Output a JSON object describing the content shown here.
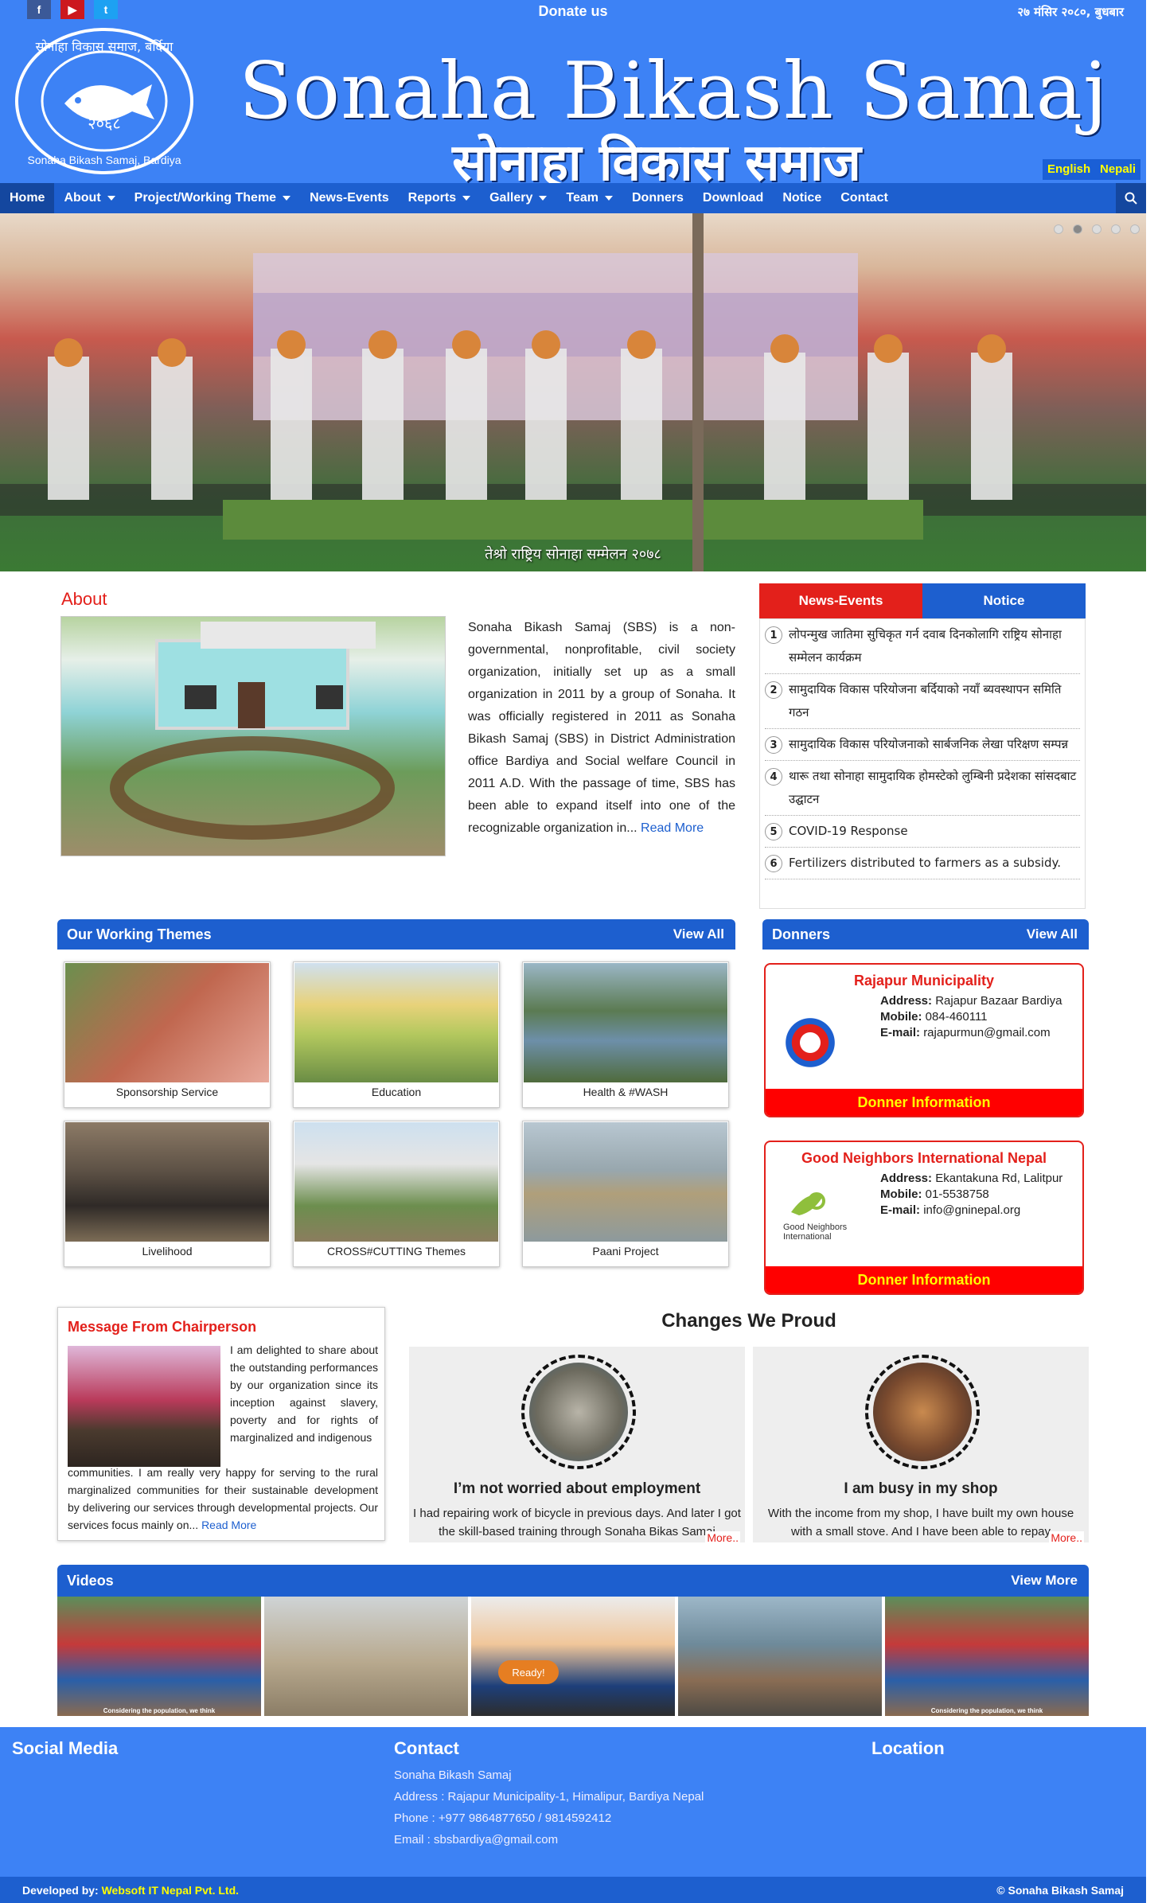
{
  "topbar": {
    "social": [
      {
        "icon": "facebook-icon",
        "glyph": "f",
        "color": "#3b5998"
      },
      {
        "icon": "youtube-icon",
        "glyph": "▶",
        "color": "#cc181e"
      },
      {
        "icon": "twitter-icon",
        "glyph": "t",
        "color": "#1da1f2"
      }
    ],
    "donate": "Donate us",
    "date": "२७ मंसिर २०८०, बुधबार"
  },
  "header": {
    "title_en": "Sonaha Bikash Samaj",
    "title_np": "सोनाहा विकास समाज",
    "logo_text_top": "सोनाहा विकास समाज, बर्दिया",
    "logo_year": "२०६८",
    "logo_text_bottom": "Sonaha Bikash Samaj, Bardiya",
    "lang_en": "English",
    "lang_np": "Nepali"
  },
  "nav": {
    "items": [
      {
        "label": "Home",
        "dropdown": false,
        "active": true
      },
      {
        "label": "About",
        "dropdown": true
      },
      {
        "label": "Project/Working Theme",
        "dropdown": true
      },
      {
        "label": "News-Events",
        "dropdown": false
      },
      {
        "label": "Reports",
        "dropdown": true
      },
      {
        "label": "Gallery",
        "dropdown": true
      },
      {
        "label": "Team",
        "dropdown": true
      },
      {
        "label": "Donners",
        "dropdown": false
      },
      {
        "label": "Download",
        "dropdown": false
      },
      {
        "label": "Notice",
        "dropdown": false
      },
      {
        "label": "Contact",
        "dropdown": false
      }
    ],
    "search_icon": "search-icon"
  },
  "slider": {
    "caption": "तेश्रो राष्ट्रिय सोनाहा सम्मेलन २०७८",
    "dots": 5,
    "active_dot": 2
  },
  "about": {
    "heading": "About",
    "text": "Sonaha Bikash Samaj (SBS) is a non-governmental, nonprofitable, civil society organization, initially set up as a small organization in 2011 by a group of Sonaha. It was officially registered in 2011 as Sonaha Bikash Samaj (SBS) in District Administration office Bardiya and Social welfare Council in 2011 A.D. With the passage of time, SBS has been able to expand itself into one of the recognizable organization in...",
    "read_more": "Read More"
  },
  "news": {
    "tab_active": "News-Events",
    "tab_other": "Notice",
    "tab_active_color": "#e3201b",
    "tab_other_color": "#1d5fcf",
    "items": [
      {
        "n": "1",
        "text": "लोपन्मुख जातिमा सुचिकृत गर्न दवाब दिनकोलागि राष्ट्रिय सोनाहा सम्मेलन कार्यक्रम"
      },
      {
        "n": "2",
        "text": "सामुदायिक विकास परियोजना बर्दियाको नयाँ ब्यवस्थापन समिति गठन"
      },
      {
        "n": "3",
        "text": "सामुदायिक विकास परियोजनाको सार्बजनिक लेखा परिक्षण सम्पन्न"
      },
      {
        "n": "4",
        "text": "थारू तथा सोनाहा सामुदायिक होमस्टेको लुम्बिनी प्रदेशका सांसदबाट उद्घाटन"
      },
      {
        "n": "5",
        "text": "COVID-19 Response"
      },
      {
        "n": "6",
        "text": "Fertilizers distributed to farmers as a subsidy."
      }
    ]
  },
  "themes": {
    "heading": "Our Working Themes",
    "view_all": "View All",
    "items": [
      {
        "label": "Sponsorship Service",
        "bg": "linear-gradient(135deg,#6b8f4e,#c0674f 50%,#e7a89a)"
      },
      {
        "label": "Education",
        "bg": "linear-gradient(180deg,#cfe0ef 0%,#e8d27a 35%,#b3c85e 60%,#6a8d45 100%)"
      },
      {
        "label": "Health & #WASH",
        "bg": "linear-gradient(180deg,#9bb7c6 0%,#5b7b52 40%,#6d8fa9 65%,#4f6b3c 100%)"
      },
      {
        "label": "Livelihood",
        "bg": "linear-gradient(180deg,#8c7a66 0%,#5e5246 40%,#2f2a27 70%,#7c6c56 100%)"
      },
      {
        "label": "CROSS#CUTTING Themes",
        "bg": "linear-gradient(180deg,#cde0ef 0%,#e5e5e5 35%,#6c8e4e 70%,#8b7d5e 100%)"
      },
      {
        "label": "Paani Project",
        "bg": "linear-gradient(180deg,#b8c7d1 0%,#98a7ae 40%,#b09f7a 60%,#8d9a9d 100%)"
      }
    ]
  },
  "donors": {
    "heading": "Donners",
    "view_all": "View All",
    "address_label": "Address:",
    "mobile_label": "Mobile:",
    "email_label": "E-mail:",
    "button": "Donner Information",
    "items": [
      {
        "name": "Rajapur Municipality",
        "address": "Rajapur Bazaar Bardiya",
        "mobile": "084-460111",
        "email": "rajapurmun@gmail.com"
      },
      {
        "name": "Good Neighbors International Nepal",
        "address": "Ekantakuna Rd, Lalitpur",
        "mobile": "01-5538758",
        "email": "info@gninepal.org",
        "logo_text": "Good Neighbors International"
      }
    ]
  },
  "chairperson": {
    "heading": "Message From Chairperson",
    "text_top": "I am delighted to share about the outstanding performances by our organization since its inception against slavery, poverty and for rights of marginalized and indigenous",
    "text_bottom": "communities. I am really very happy for serving to the rural marginalized communities for their sustainable development by delivering our services through developmental projects. Our services focus mainly on...",
    "read_more": "Read More"
  },
  "proud": {
    "heading": "Changes We Proud",
    "more": "More..",
    "items": [
      {
        "title": "I’m not worried about employment",
        "body": "I had repairing work of bicycle in previous days. And later I got the skill-based training through Sonaha Bikas Samaj",
        "bg": "radial-gradient(circle,#b8b4a8,#6c6a5e 60%,#3f5b6e)"
      },
      {
        "title": "I am busy in my shop",
        "body": "With the income from my shop, I have built my own house with a small stove. And I have been able to repay",
        "bg": "radial-gradient(circle,#c98a4f,#7a4a2e 55%,#3a2d2a)"
      }
    ]
  },
  "videos": {
    "heading": "Videos",
    "view_more": "View More",
    "items": [
      {
        "caption": "Considering the population, we think",
        "bg": "linear-gradient(180deg,#5b8f5a 0%,#c53a3a 40%,#2a5fa8 70%,#8a6a4f 100%)"
      },
      {
        "caption": "",
        "bg": "linear-gradient(180deg,#cfd4d6 0%,#b8a98e 55%,#8b7d66 100%)"
      },
      {
        "caption": "",
        "bg": "linear-gradient(180deg,#ececec 0%,#f0c69a 40%,#1d3f7a 75%,#2d2d2d 100%)",
        "overlay": "Ready!"
      },
      {
        "caption": "",
        "bg": "linear-gradient(180deg,#9db7c8 0%,#6e8a9a 40%,#8a6d54 70%,#4d4a44 100%)"
      },
      {
        "caption": "Considering the population, we think",
        "bg": "linear-gradient(180deg,#5b8f5a 0%,#c53a3a 40%,#2a5fa8 70%,#8a6a4f 100%)"
      }
    ]
  },
  "footer": {
    "social_heading": "Social Media",
    "contact_heading": "Contact",
    "location_heading": "Location",
    "org": "Sonaha Bikash Samaj",
    "address": "Address : Rajapur Municipality-1, Himalipur, Bardiya Nepal",
    "phone": "Phone : +977 9864877650 / 9814592412",
    "email": "Email : sbsbardiya@gmail.com",
    "developed_label": "Developed by:",
    "developer": "Websoft IT Nepal Pvt. Ltd.",
    "copyright": "© Sonaha Bikash Samaj"
  }
}
